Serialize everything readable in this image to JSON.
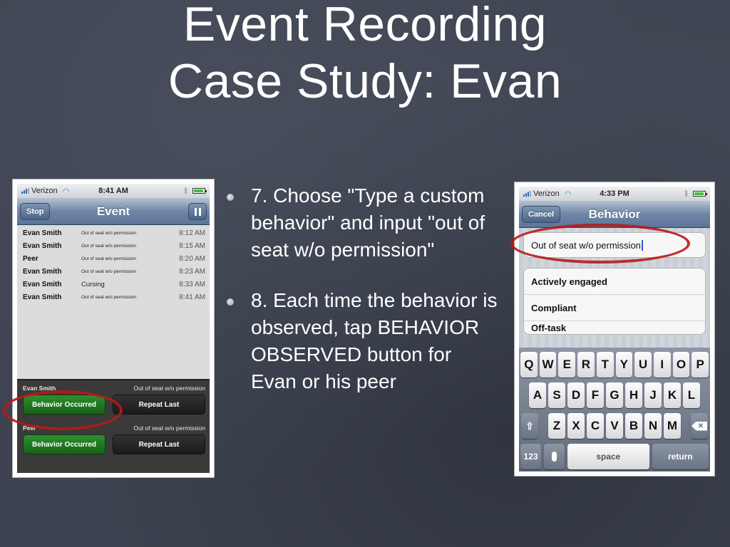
{
  "slide": {
    "title_lines": [
      "Event Recording",
      "Case Study: Evan"
    ],
    "bullets": [
      "7. Choose \"Type a custom behavior\" and input \"out of seat w/o permission\"",
      "8. Each time the behavior is observed, tap BEHAVIOR OBSERVED button for Evan or his peer"
    ]
  },
  "left_phone": {
    "status": {
      "carrier": "Verizon",
      "time": "8:41 AM"
    },
    "nav": {
      "title": "Event",
      "left_button": "Stop",
      "right_button_icon": "pause-icon"
    },
    "events": [
      {
        "name": "Evan Smith",
        "behavior": "Out of seat w/o permission",
        "time": "8:12 AM"
      },
      {
        "name": "Evan Smith",
        "behavior": "Out of seat w/o permission",
        "time": "8:15 AM"
      },
      {
        "name": "Peer",
        "behavior": "Out of seat w/o permission",
        "time": "8:20 AM"
      },
      {
        "name": "Evan Smith",
        "behavior": "Out of seat w/o permission",
        "time": "8:23 AM"
      },
      {
        "name": "Evan Smith",
        "behavior": "Cursing",
        "time": "8:33 AM"
      },
      {
        "name": "Evan Smith",
        "behavior": "Out of seat w/o permission",
        "time": "8:41 AM"
      }
    ],
    "panel": [
      {
        "who": "Evan Smith",
        "last_behavior": "Out of seat w/o permission",
        "occurred_label": "Behavior Occurred",
        "repeat_label": "Repeat Last"
      },
      {
        "who": "Peer",
        "last_behavior": "Out of seat w/o permission",
        "occurred_label": "Behavior Occurred",
        "repeat_label": "Repeat Last"
      }
    ],
    "highlight_color": "#b81a1a"
  },
  "right_phone": {
    "status": {
      "carrier": "Verizon",
      "time": "4:33 PM"
    },
    "nav": {
      "title": "Behavior",
      "left_button": "Cancel"
    },
    "input_value": "Out of seat w/o permission",
    "options": [
      "Actively engaged",
      "Compliant",
      "Off-task"
    ],
    "keyboard": {
      "row1": [
        "Q",
        "W",
        "E",
        "R",
        "T",
        "Y",
        "U",
        "I",
        "O",
        "P"
      ],
      "row2": [
        "A",
        "S",
        "D",
        "F",
        "G",
        "H",
        "J",
        "K",
        "L"
      ],
      "row3": [
        "Z",
        "X",
        "C",
        "V",
        "B",
        "N",
        "M"
      ],
      "numbers_label": "123",
      "space_label": "space",
      "return_label": "return"
    }
  }
}
